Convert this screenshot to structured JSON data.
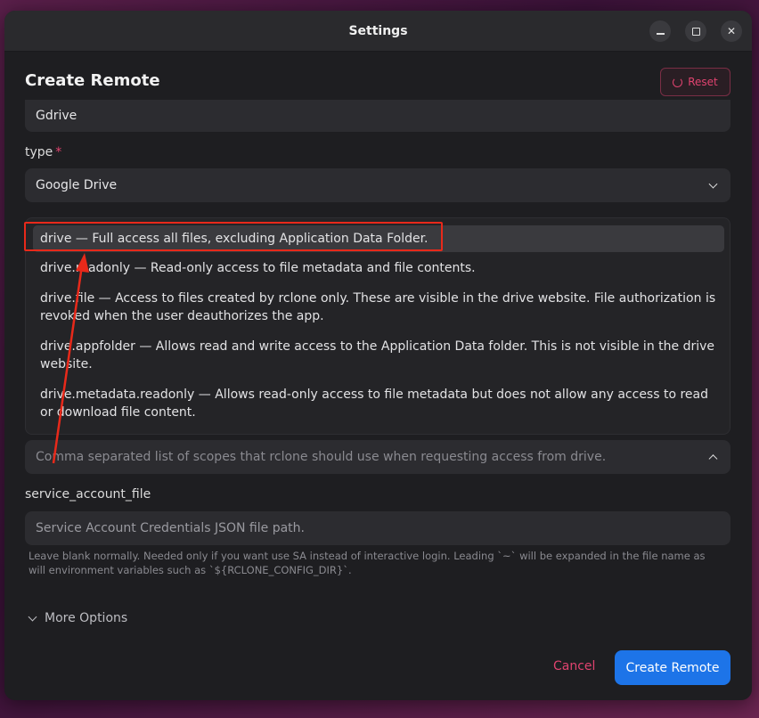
{
  "window": {
    "title": "Settings"
  },
  "header": {
    "title": "Create Remote",
    "reset_label": "Reset"
  },
  "name_field": {
    "value": "Gdrive"
  },
  "type_field": {
    "label": "type",
    "required_mark": "*",
    "value": "Google Drive"
  },
  "scope_options": [
    "drive — Full access all files, excluding Application Data Folder.",
    "drive.readonly — Read-only access to file metadata and file contents.",
    "drive.file — Access to files created by rclone only. These are visible in the drive website. File authorization is revoked when the user deauthorizes the app.",
    "drive.appfolder — Allows read and write access to the Application Data folder. This is not visible in the drive website.",
    "drive.metadata.readonly — Allows read-only access to file metadata but does not allow any access to read or download file content."
  ],
  "scope_field": {
    "placeholder": "Comma separated list of scopes that rclone should use when requesting access from drive."
  },
  "service_account": {
    "label": "service_account_file",
    "placeholder": "Service Account Credentials JSON file path.",
    "help": "Leave blank normally. Needed only if you want use SA instead of interactive login. Leading `~` will be expanded in the file name as will environment variables such as `${RCLONE_CONFIG_DIR}`."
  },
  "more_options_label": "More Options",
  "footer": {
    "cancel_label": "Cancel",
    "create_label": "Create Remote"
  },
  "colors": {
    "accent": "#1d74e8",
    "danger": "#e0436f",
    "annotation": "#e8291a"
  }
}
